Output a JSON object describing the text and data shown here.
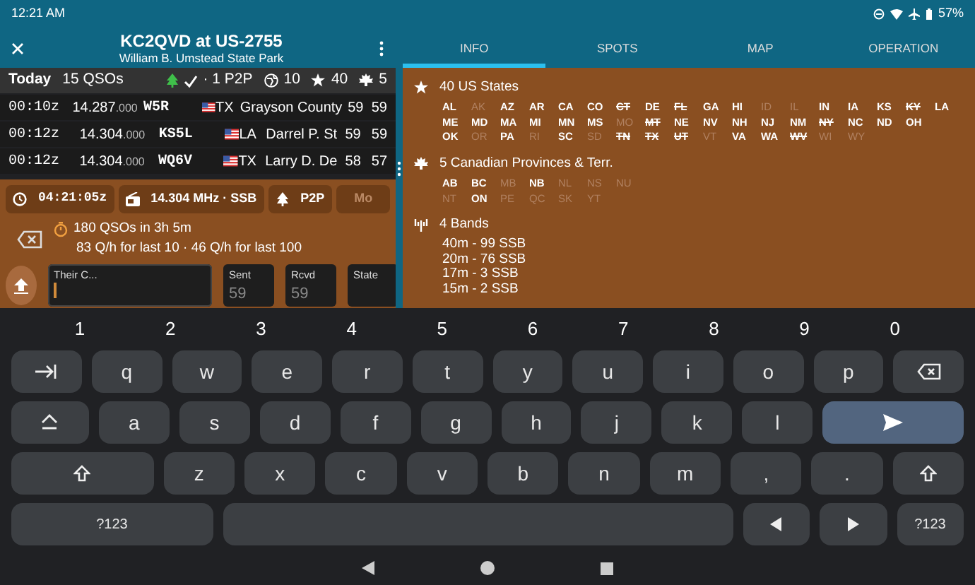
{
  "status_bar": {
    "time": "12:21 AM",
    "battery": "57%"
  },
  "header": {
    "title": "KC2QVD at US-2755",
    "subtitle": "William B. Umstead State Park"
  },
  "today_bar": {
    "label": "Today",
    "count": "15 QSOs",
    "stats": [
      {
        "kind": "p2p",
        "text": "· 1 P2P"
      },
      {
        "kind": "dxcc",
        "text": "10"
      },
      {
        "kind": "states",
        "text": "40"
      },
      {
        "kind": "provinces",
        "text": "5"
      }
    ]
  },
  "qsos": [
    {
      "time": "00:10z",
      "freq": "14.287",
      "freq_fraction": ".000",
      "call": "W5R",
      "state": "TX",
      "name": "Grayson County",
      "sent": "59",
      "rcvd": "59"
    },
    {
      "time": "00:12z",
      "freq": "14.304",
      "freq_fraction": ".000",
      "call": "KS5L",
      "state": "LA",
      "name": "Darrel P. St",
      "sent": "59",
      "rcvd": "59"
    },
    {
      "time": "00:12z",
      "freq": "14.304",
      "freq_fraction": ".000",
      "call": "WQ6V",
      "state": "TX",
      "name": "Larry D. De",
      "sent": "58",
      "rcvd": "57"
    }
  ],
  "chips": [
    {
      "kind": "clock",
      "text": "04:21:05z"
    },
    {
      "kind": "radio",
      "text": "14.304 MHz · SSB"
    },
    {
      "kind": "p2p",
      "text": "P2P"
    },
    {
      "kind": "edit",
      "text": "Mo"
    }
  ],
  "rate": {
    "summary": "180 QSOs in 3h 5m",
    "detail": "83 Q/h for last 10 · 46 Q/h for last 100"
  },
  "fields": [
    {
      "label": "Their C...",
      "focused": true
    },
    {
      "label": "Sent",
      "placeholder": "59",
      "focused": false
    },
    {
      "label": "Rcvd",
      "placeholder": "59",
      "focused": false
    },
    {
      "label": "State",
      "focused": false
    }
  ],
  "tabs": [
    {
      "label": "INFO",
      "selected": true
    },
    {
      "label": "SPOTS",
      "selected": false
    },
    {
      "label": "MAP",
      "selected": false
    },
    {
      "label": "OPERATION",
      "selected": false
    }
  ],
  "info": {
    "states": {
      "title": "40 US States",
      "lines": [
        {
          "items": [
            {
              "code": "AL",
              "worked": true,
              "struck": false
            },
            {
              "code": "AK",
              "worked": false,
              "struck": false
            },
            {
              "code": "AZ",
              "worked": true,
              "struck": false
            },
            {
              "code": "AR",
              "worked": true,
              "struck": false
            },
            {
              "code": "CA",
              "worked": true,
              "struck": false
            },
            {
              "code": "CO",
              "worked": true,
              "struck": false
            },
            {
              "code": "CT",
              "worked": true,
              "struck": true
            },
            {
              "code": "DE",
              "worked": true,
              "struck": false
            },
            {
              "code": "FL",
              "worked": true,
              "struck": true
            },
            {
              "code": "GA",
              "worked": true,
              "struck": false
            },
            {
              "code": "HI",
              "worked": true,
              "struck": false
            },
            {
              "code": "ID",
              "worked": false,
              "struck": false
            },
            {
              "code": "IL",
              "worked": false,
              "struck": false
            },
            {
              "code": "IN",
              "worked": true,
              "struck": false
            },
            {
              "code": "IA",
              "worked": true,
              "struck": false
            },
            {
              "code": "KS",
              "worked": true,
              "struck": false
            },
            {
              "code": "KY",
              "worked": true,
              "struck": true
            },
            {
              "code": "LA",
              "worked": true,
              "struck": false
            }
          ]
        },
        {
          "items": [
            {
              "code": "ME",
              "worked": true,
              "struck": false
            },
            {
              "code": "MD",
              "worked": true,
              "struck": false
            },
            {
              "code": "MA",
              "worked": true,
              "struck": false
            },
            {
              "code": "MI",
              "worked": true,
              "struck": false
            },
            {
              "code": "MN",
              "worked": true,
              "struck": false
            },
            {
              "code": "MS",
              "worked": true,
              "struck": false
            },
            {
              "code": "MO",
              "worked": false,
              "struck": false
            },
            {
              "code": "MT",
              "worked": true,
              "struck": true
            },
            {
              "code": "NE",
              "worked": true,
              "struck": false
            },
            {
              "code": "NV",
              "worked": true,
              "struck": false
            },
            {
              "code": "NH",
              "worked": true,
              "struck": false
            },
            {
              "code": "NJ",
              "worked": true,
              "struck": false
            },
            {
              "code": "NM",
              "worked": true,
              "struck": false
            },
            {
              "code": "NY",
              "worked": true,
              "struck": true
            },
            {
              "code": "NC",
              "worked": true,
              "struck": false
            },
            {
              "code": "ND",
              "worked": true,
              "struck": false
            },
            {
              "code": "OH",
              "worked": true,
              "struck": false
            }
          ]
        },
        {
          "items": [
            {
              "code": "OK",
              "worked": true,
              "struck": false
            },
            {
              "code": "OR",
              "worked": false,
              "struck": false
            },
            {
              "code": "PA",
              "worked": true,
              "struck": false
            },
            {
              "code": "RI",
              "worked": false,
              "struck": false
            },
            {
              "code": "SC",
              "worked": true,
              "struck": false
            },
            {
              "code": "SD",
              "worked": false,
              "struck": false
            },
            {
              "code": "TN",
              "worked": true,
              "struck": true
            },
            {
              "code": "TX",
              "worked": true,
              "struck": true
            },
            {
              "code": "UT",
              "worked": true,
              "struck": true
            },
            {
              "code": "VT",
              "worked": false,
              "struck": false
            },
            {
              "code": "VA",
              "worked": true,
              "struck": false
            },
            {
              "code": "WA",
              "worked": true,
              "struck": false
            },
            {
              "code": "WV",
              "worked": true,
              "struck": true
            },
            {
              "code": "WI",
              "worked": false,
              "struck": false
            },
            {
              "code": "WY",
              "worked": false,
              "struck": false
            }
          ]
        }
      ]
    },
    "provinces": {
      "title": "5 Canadian Provinces & Terr.",
      "lines": [
        {
          "items": [
            {
              "code": "AB",
              "worked": true,
              "struck": false
            },
            {
              "code": "BC",
              "worked": true,
              "struck": false
            },
            {
              "code": "MB",
              "worked": false,
              "struck": false
            },
            {
              "code": "NB",
              "worked": true,
              "struck": false
            },
            {
              "code": "NL",
              "worked": false,
              "struck": false
            },
            {
              "code": "NS",
              "worked": false,
              "struck": false
            },
            {
              "code": "NU",
              "worked": false,
              "struck": false
            }
          ]
        },
        {
          "items": [
            {
              "code": "NT",
              "worked": false,
              "struck": false
            },
            {
              "code": "ON",
              "worked": true,
              "struck": false
            },
            {
              "code": "PE",
              "worked": false,
              "struck": false
            },
            {
              "code": "QC",
              "worked": false,
              "struck": false
            },
            {
              "code": "SK",
              "worked": false,
              "struck": false
            },
            {
              "code": "YT",
              "worked": false,
              "struck": false
            }
          ]
        }
      ]
    },
    "bands": {
      "title": "4 Bands",
      "lines": [
        "40m -  99 SSB",
        "20m -  76 SSB",
        "17m -  3 SSB",
        "15m -  2 SSB"
      ]
    }
  },
  "keyboard": {
    "digits": [
      "1",
      "2",
      "3",
      "4",
      "5",
      "6",
      "7",
      "8",
      "9",
      "0"
    ],
    "rows": [
      {
        "keys": [
          {
            "kind": "tab"
          },
          {
            "kind": "char",
            "label": "q"
          },
          {
            "kind": "char",
            "label": "w"
          },
          {
            "kind": "char",
            "label": "e"
          },
          {
            "kind": "char",
            "label": "r"
          },
          {
            "kind": "char",
            "label": "t"
          },
          {
            "kind": "char",
            "label": "y"
          },
          {
            "kind": "char",
            "label": "u"
          },
          {
            "kind": "char",
            "label": "i"
          },
          {
            "kind": "char",
            "label": "o"
          },
          {
            "kind": "char",
            "label": "p"
          },
          {
            "kind": "backspace"
          }
        ]
      },
      {
        "keys": [
          {
            "kind": "caps"
          },
          {
            "kind": "char",
            "label": "a"
          },
          {
            "kind": "char",
            "label": "s"
          },
          {
            "kind": "char",
            "label": "d"
          },
          {
            "kind": "char",
            "label": "f"
          },
          {
            "kind": "char",
            "label": "g"
          },
          {
            "kind": "char",
            "label": "h"
          },
          {
            "kind": "char",
            "label": "j"
          },
          {
            "kind": "char",
            "label": "k"
          },
          {
            "kind": "char",
            "label": "l"
          },
          {
            "kind": "enter"
          }
        ]
      },
      {
        "keys": [
          {
            "kind": "shift"
          },
          {
            "kind": "char",
            "label": "z"
          },
          {
            "kind": "char",
            "label": "x"
          },
          {
            "kind": "char",
            "label": "c"
          },
          {
            "kind": "char",
            "label": "v"
          },
          {
            "kind": "char",
            "label": "b"
          },
          {
            "kind": "char",
            "label": "n"
          },
          {
            "kind": "char",
            "label": "m"
          },
          {
            "kind": "char",
            "label": ","
          },
          {
            "kind": "char",
            "label": "."
          },
          {
            "kind": "shift"
          }
        ]
      },
      {
        "keys": [
          {
            "kind": "mode",
            "label": "?123"
          },
          {
            "kind": "space"
          },
          {
            "kind": "left"
          },
          {
            "kind": "right"
          },
          {
            "kind": "mode",
            "label": "?123"
          }
        ]
      }
    ]
  }
}
